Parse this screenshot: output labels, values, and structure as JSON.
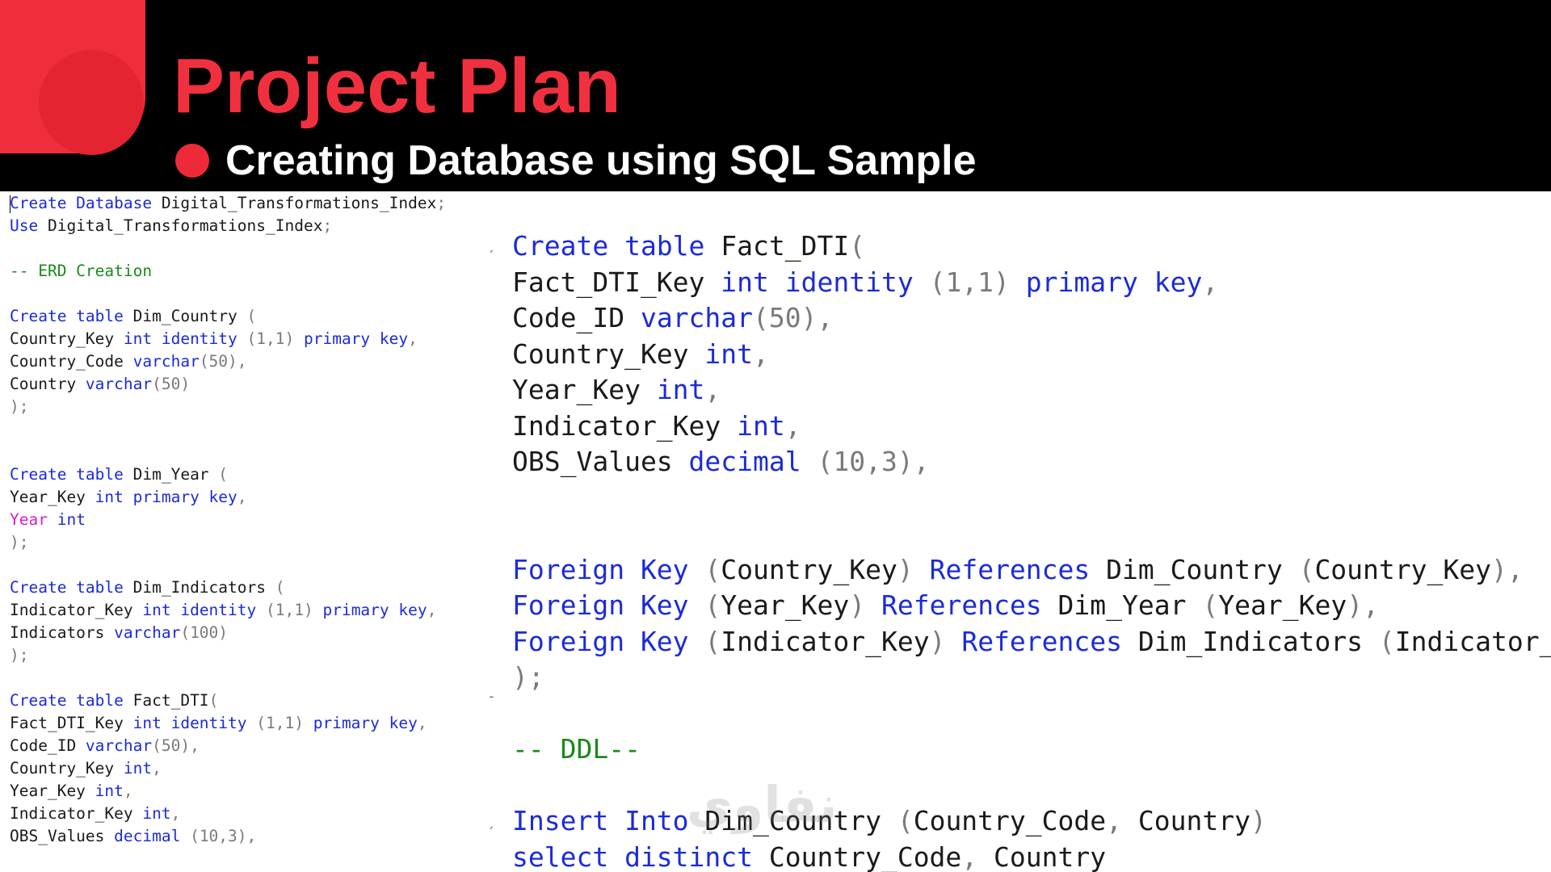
{
  "slide": {
    "title": "Project Plan",
    "subtitle": "Creating Database using SQL Sample",
    "accent_color": "#ef2d3b",
    "watermark_text": "نفاوي"
  },
  "left_code": [
    [
      [
        "kw",
        "Create Database"
      ],
      [
        "tx",
        " Digital_Transformations_Index"
      ],
      [
        "pn",
        ";"
      ]
    ],
    [
      [
        "kw",
        "Use"
      ],
      [
        "tx",
        " Digital_Transformations_Index"
      ],
      [
        "pn",
        ";"
      ]
    ],
    [],
    [
      [
        "cm",
        "-- ERD Creation"
      ]
    ],
    [],
    [
      [
        "kw",
        "Create table"
      ],
      [
        "tx",
        " Dim_Country "
      ],
      [
        "pn",
        "("
      ]
    ],
    [
      [
        "tx",
        "Country_Key "
      ],
      [
        "kw",
        "int identity"
      ],
      [
        "tx",
        " "
      ],
      [
        "pn",
        "(1,1)"
      ],
      [
        "tx",
        " "
      ],
      [
        "kw",
        "primary key"
      ],
      [
        "pn",
        ","
      ]
    ],
    [
      [
        "tx",
        "Country_Code "
      ],
      [
        "kw",
        "varchar"
      ],
      [
        "pn",
        "(50),"
      ]
    ],
    [
      [
        "tx",
        "Country "
      ],
      [
        "kw",
        "varchar"
      ],
      [
        "pn",
        "(50)"
      ]
    ],
    [
      [
        "pn",
        ");"
      ]
    ],
    [],
    [],
    [
      [
        "kw",
        "Create table"
      ],
      [
        "tx",
        " Dim_Year "
      ],
      [
        "pn",
        "("
      ]
    ],
    [
      [
        "tx",
        "Year_Key "
      ],
      [
        "kw",
        "int primary key"
      ],
      [
        "pn",
        ","
      ]
    ],
    [
      [
        "fn",
        "Year"
      ],
      [
        "tx",
        " "
      ],
      [
        "kw",
        "int"
      ]
    ],
    [
      [
        "pn",
        ");"
      ]
    ],
    [],
    [
      [
        "kw",
        "Create table"
      ],
      [
        "tx",
        " Dim_Indicators "
      ],
      [
        "pn",
        "("
      ]
    ],
    [
      [
        "tx",
        "Indicator_Key "
      ],
      [
        "kw",
        "int identity"
      ],
      [
        "tx",
        " "
      ],
      [
        "pn",
        "(1,1)"
      ],
      [
        "tx",
        " "
      ],
      [
        "kw",
        "primary key"
      ],
      [
        "pn",
        ","
      ]
    ],
    [
      [
        "tx",
        "Indicators "
      ],
      [
        "kw",
        "varchar"
      ],
      [
        "pn",
        "(100)"
      ]
    ],
    [
      [
        "pn",
        ");"
      ]
    ],
    [],
    [
      [
        "kw",
        "Create table"
      ],
      [
        "tx",
        " Fact_DTI"
      ],
      [
        "pn",
        "("
      ]
    ],
    [
      [
        "tx",
        "Fact_DTI_Key "
      ],
      [
        "kw",
        "int identity"
      ],
      [
        "tx",
        " "
      ],
      [
        "pn",
        "(1,1)"
      ],
      [
        "tx",
        " "
      ],
      [
        "kw",
        "primary key"
      ],
      [
        "pn",
        ","
      ]
    ],
    [
      [
        "tx",
        "Code_ID "
      ],
      [
        "kw",
        "varchar"
      ],
      [
        "pn",
        "(50),"
      ]
    ],
    [
      [
        "tx",
        "Country_Key "
      ],
      [
        "kw",
        "int"
      ],
      [
        "pn",
        ","
      ]
    ],
    [
      [
        "tx",
        "Year_Key "
      ],
      [
        "kw",
        "int"
      ],
      [
        "pn",
        ","
      ]
    ],
    [
      [
        "tx",
        "Indicator_Key "
      ],
      [
        "kw",
        "int"
      ],
      [
        "pn",
        ","
      ]
    ],
    [
      [
        "tx",
        "OBS_Values "
      ],
      [
        "kw",
        "decimal"
      ],
      [
        "tx",
        " "
      ],
      [
        "pn",
        "(10,3),"
      ]
    ]
  ],
  "right_code": [
    [
      [
        "kw",
        "Create table"
      ],
      [
        "tx",
        " Fact_DTI"
      ],
      [
        "pn",
        "("
      ]
    ],
    [
      [
        "tx",
        "Fact_DTI_Key "
      ],
      [
        "kw",
        "int identity"
      ],
      [
        "tx",
        " "
      ],
      [
        "pn",
        "(1,1)"
      ],
      [
        "tx",
        " "
      ],
      [
        "kw",
        "primary key"
      ],
      [
        "pn",
        ","
      ]
    ],
    [
      [
        "tx",
        "Code_ID "
      ],
      [
        "kw",
        "varchar"
      ],
      [
        "pn",
        "(50),"
      ]
    ],
    [
      [
        "tx",
        "Country_Key "
      ],
      [
        "kw",
        "int"
      ],
      [
        "pn",
        ","
      ]
    ],
    [
      [
        "tx",
        "Year_Key "
      ],
      [
        "kw",
        "int"
      ],
      [
        "pn",
        ","
      ]
    ],
    [
      [
        "tx",
        "Indicator_Key "
      ],
      [
        "kw",
        "int"
      ],
      [
        "pn",
        ","
      ]
    ],
    [
      [
        "tx",
        "OBS_Values "
      ],
      [
        "kw",
        "decimal"
      ],
      [
        "tx",
        " "
      ],
      [
        "pn",
        "(10,3),"
      ]
    ],
    [],
    [],
    [
      [
        "kw",
        "Foreign Key"
      ],
      [
        "tx",
        " "
      ],
      [
        "pn",
        "("
      ],
      [
        "tx",
        "Country_Key"
      ],
      [
        "pn",
        ")"
      ],
      [
        "tx",
        " "
      ],
      [
        "kw",
        "References"
      ],
      [
        "tx",
        " Dim_Country "
      ],
      [
        "pn",
        "("
      ],
      [
        "tx",
        "Country_Key"
      ],
      [
        "pn",
        "),"
      ]
    ],
    [
      [
        "kw",
        "Foreign Key"
      ],
      [
        "tx",
        " "
      ],
      [
        "pn",
        "("
      ],
      [
        "tx",
        "Year_Key"
      ],
      [
        "pn",
        ")"
      ],
      [
        "tx",
        " "
      ],
      [
        "kw",
        "References"
      ],
      [
        "tx",
        " Dim_Year "
      ],
      [
        "pn",
        "("
      ],
      [
        "tx",
        "Year_Key"
      ],
      [
        "pn",
        "),"
      ]
    ],
    [
      [
        "kw",
        "Foreign Key"
      ],
      [
        "tx",
        " "
      ],
      [
        "pn",
        "("
      ],
      [
        "tx",
        "Indicator_Key"
      ],
      [
        "pn",
        ")"
      ],
      [
        "tx",
        " "
      ],
      [
        "kw",
        "References"
      ],
      [
        "tx",
        " Dim_Indicators "
      ],
      [
        "pn",
        "("
      ],
      [
        "tx",
        "Indicator_"
      ]
    ],
    [
      [
        "pn",
        ");"
      ]
    ],
    [],
    [
      [
        "cm",
        "-- DDL--"
      ]
    ],
    [],
    [
      [
        "kw",
        "Insert Into"
      ],
      [
        "tx",
        " Dim_Country "
      ],
      [
        "pn",
        "("
      ],
      [
        "tx",
        "Country_Code"
      ],
      [
        "pn",
        ","
      ],
      [
        "tx",
        " Country"
      ],
      [
        "pn",
        ")"
      ]
    ],
    [
      [
        "kw",
        "select distinct"
      ],
      [
        "tx",
        " Country_Code"
      ],
      [
        "pn",
        ","
      ],
      [
        "tx",
        " Country"
      ]
    ]
  ]
}
